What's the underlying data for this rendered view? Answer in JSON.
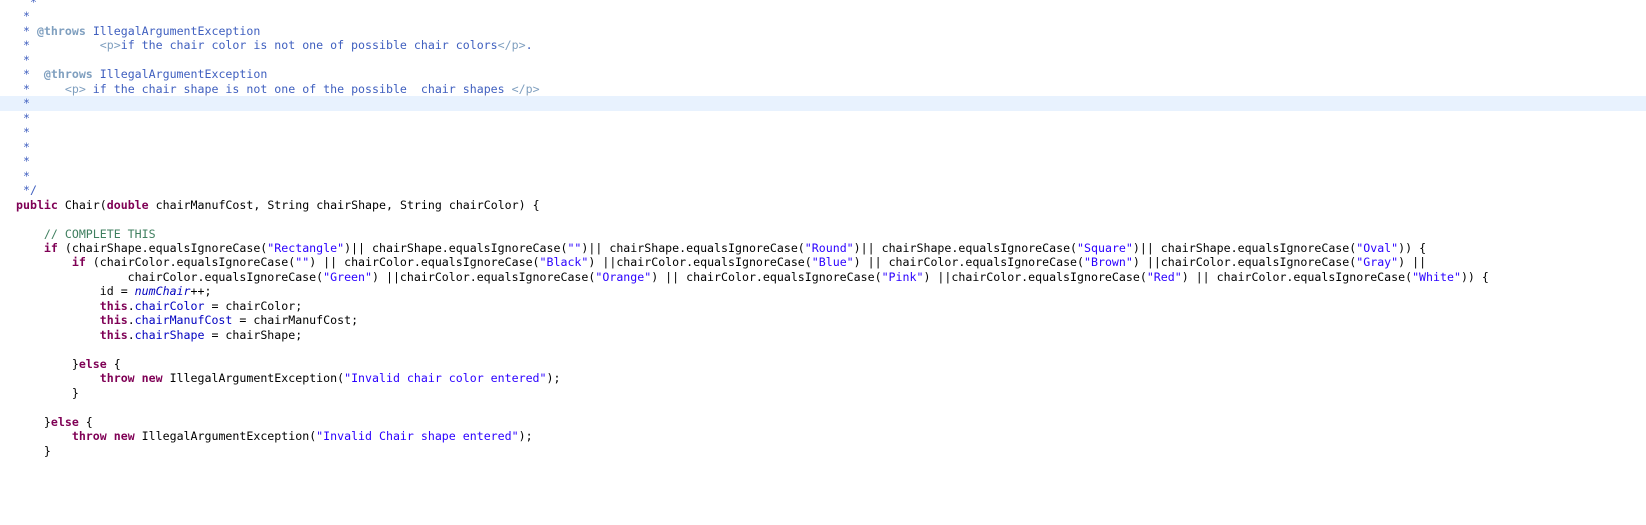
{
  "editor": {
    "app": "java-code-editor",
    "language": "Java",
    "theme_colors": {
      "background": "#ffffff",
      "current_line_highlight": "#e8f2fe",
      "javadoc": "#3f5fbf",
      "javadoc_tag": "#7f9fbf",
      "comment": "#3f7f5f",
      "keyword": "#7f0055",
      "string": "#2a00ff",
      "field": "#0000c0",
      "text": "#000000"
    },
    "highlighted_line_index": 7,
    "lines": [
      {
        "indent": 0,
        "tokens": [
          {
            "t": "  * ",
            "c": "jdoc"
          }
        ]
      },
      {
        "indent": 0,
        "tokens": [
          {
            "t": " * ",
            "c": "jdoc"
          }
        ]
      },
      {
        "indent": 0,
        "tokens": [
          {
            "t": " * ",
            "c": "jdoc"
          },
          {
            "t": "@throws",
            "c": "jdoc-kw"
          },
          {
            "t": " ",
            "c": "jdoc"
          },
          {
            "t": "IllegalArgumentException",
            "c": "jdoc"
          }
        ]
      },
      {
        "indent": 0,
        "tokens": [
          {
            "t": " *          ",
            "c": "jdoc"
          },
          {
            "t": "<p>",
            "c": "jdoc-tag"
          },
          {
            "t": "if the chair color is not one of possible chair colors",
            "c": "jdoc"
          },
          {
            "t": "</p>",
            "c": "jdoc-tag"
          },
          {
            "t": ".",
            "c": "jdoc"
          }
        ]
      },
      {
        "indent": 0,
        "tokens": [
          {
            "t": " * ",
            "c": "jdoc"
          }
        ]
      },
      {
        "indent": 0,
        "tokens": [
          {
            "t": " *  ",
            "c": "jdoc"
          },
          {
            "t": "@throws",
            "c": "jdoc-kw"
          },
          {
            "t": " ",
            "c": "jdoc"
          },
          {
            "t": "IllegalArgumentException",
            "c": "jdoc"
          }
        ]
      },
      {
        "indent": 0,
        "tokens": [
          {
            "t": " *     ",
            "c": "jdoc"
          },
          {
            "t": "<p>",
            "c": "jdoc-tag"
          },
          {
            "t": " if the chair shape is not one of the possible  chair shapes ",
            "c": "jdoc"
          },
          {
            "t": "</p>",
            "c": "jdoc-tag"
          }
        ]
      },
      {
        "indent": 0,
        "tokens": [
          {
            "t": " * ",
            "c": "jdoc"
          }
        ]
      },
      {
        "indent": 0,
        "tokens": [
          {
            "t": " * ",
            "c": "jdoc"
          }
        ]
      },
      {
        "indent": 0,
        "tokens": [
          {
            "t": " * ",
            "c": "jdoc"
          }
        ]
      },
      {
        "indent": 0,
        "tokens": [
          {
            "t": " * ",
            "c": "jdoc"
          }
        ]
      },
      {
        "indent": 0,
        "tokens": [
          {
            "t": " * ",
            "c": "jdoc"
          }
        ]
      },
      {
        "indent": 0,
        "tokens": [
          {
            "t": " * ",
            "c": "jdoc"
          }
        ]
      },
      {
        "indent": 0,
        "tokens": [
          {
            "t": " */",
            "c": "jdoc"
          }
        ]
      },
      {
        "indent": 0,
        "tokens": [
          {
            "t": "public",
            "c": "kw"
          },
          {
            "t": " Chair(",
            "c": "plain"
          },
          {
            "t": "double",
            "c": "kw"
          },
          {
            "t": " chairManufCost, ",
            "c": "plain"
          },
          {
            "t": "String",
            "c": "plain"
          },
          {
            "t": " chairShape, ",
            "c": "plain"
          },
          {
            "t": "String",
            "c": "plain"
          },
          {
            "t": " chairColor) {",
            "c": "plain"
          }
        ]
      },
      {
        "indent": 0,
        "tokens": []
      },
      {
        "indent": 0,
        "tokens": [
          {
            "t": "    ",
            "c": "plain"
          },
          {
            "t": "// COMPLETE THIS",
            "c": "cmt"
          }
        ]
      },
      {
        "indent": 0,
        "tokens": [
          {
            "t": "    ",
            "c": "plain"
          },
          {
            "t": "if",
            "c": "kw"
          },
          {
            "t": " (chairShape.equalsIgnoreCase(",
            "c": "plain"
          },
          {
            "t": "\"Rectangle\"",
            "c": "str"
          },
          {
            "t": ")|| chairShape.equalsIgnoreCase(",
            "c": "plain"
          },
          {
            "t": "\"\"",
            "c": "str"
          },
          {
            "t": ")|| chairShape.equalsIgnoreCase(",
            "c": "plain"
          },
          {
            "t": "\"Round\"",
            "c": "str"
          },
          {
            "t": ")|| chairShape.equalsIgnoreCase(",
            "c": "plain"
          },
          {
            "t": "\"Square\"",
            "c": "str"
          },
          {
            "t": ")|| chairShape.equalsIgnoreCase(",
            "c": "plain"
          },
          {
            "t": "\"Oval\"",
            "c": "str"
          },
          {
            "t": ")) {",
            "c": "plain"
          }
        ]
      },
      {
        "indent": 0,
        "tokens": [
          {
            "t": "        ",
            "c": "plain"
          },
          {
            "t": "if",
            "c": "kw"
          },
          {
            "t": " (chairColor.equalsIgnoreCase(",
            "c": "plain"
          },
          {
            "t": "\"\"",
            "c": "str"
          },
          {
            "t": ") || chairColor.equalsIgnoreCase(",
            "c": "plain"
          },
          {
            "t": "\"Black\"",
            "c": "str"
          },
          {
            "t": ") ||chairColor.equalsIgnoreCase(",
            "c": "plain"
          },
          {
            "t": "\"Blue\"",
            "c": "str"
          },
          {
            "t": ") || chairColor.equalsIgnoreCase(",
            "c": "plain"
          },
          {
            "t": "\"Brown\"",
            "c": "str"
          },
          {
            "t": ") ||chairColor.equalsIgnoreCase(",
            "c": "plain"
          },
          {
            "t": "\"Gray\"",
            "c": "str"
          },
          {
            "t": ") ||",
            "c": "plain"
          }
        ]
      },
      {
        "indent": 0,
        "tokens": [
          {
            "t": "                chairColor.equalsIgnoreCase(",
            "c": "plain"
          },
          {
            "t": "\"Green\"",
            "c": "str"
          },
          {
            "t": ") ||chairColor.equalsIgnoreCase(",
            "c": "plain"
          },
          {
            "t": "\"Orange\"",
            "c": "str"
          },
          {
            "t": ") || chairColor.equalsIgnoreCase(",
            "c": "plain"
          },
          {
            "t": "\"Pink\"",
            "c": "str"
          },
          {
            "t": ") ||chairColor.equalsIgnoreCase(",
            "c": "plain"
          },
          {
            "t": "\"Red\"",
            "c": "str"
          },
          {
            "t": ") || chairColor.equalsIgnoreCase(",
            "c": "plain"
          },
          {
            "t": "\"White\"",
            "c": "str"
          },
          {
            "t": ")) {",
            "c": "plain"
          }
        ]
      },
      {
        "indent": 0,
        "tokens": [
          {
            "t": "            id = ",
            "c": "plain"
          },
          {
            "t": "numChair",
            "c": "sfld"
          },
          {
            "t": "++;",
            "c": "plain"
          }
        ]
      },
      {
        "indent": 0,
        "tokens": [
          {
            "t": "            ",
            "c": "plain"
          },
          {
            "t": "this",
            "c": "kw"
          },
          {
            "t": ".",
            "c": "plain"
          },
          {
            "t": "chairColor",
            "c": "fld"
          },
          {
            "t": " = chairColor;",
            "c": "plain"
          }
        ]
      },
      {
        "indent": 0,
        "tokens": [
          {
            "t": "            ",
            "c": "plain"
          },
          {
            "t": "this",
            "c": "kw"
          },
          {
            "t": ".",
            "c": "plain"
          },
          {
            "t": "chairManufCost",
            "c": "fld"
          },
          {
            "t": " = chairManufCost;",
            "c": "plain"
          }
        ]
      },
      {
        "indent": 0,
        "tokens": [
          {
            "t": "            ",
            "c": "plain"
          },
          {
            "t": "this",
            "c": "kw"
          },
          {
            "t": ".",
            "c": "plain"
          },
          {
            "t": "chairShape",
            "c": "fld"
          },
          {
            "t": " = chairShape;",
            "c": "plain"
          }
        ]
      },
      {
        "indent": 0,
        "tokens": []
      },
      {
        "indent": 0,
        "tokens": [
          {
            "t": "        }",
            "c": "plain"
          },
          {
            "t": "else",
            "c": "kw"
          },
          {
            "t": " {",
            "c": "plain"
          }
        ]
      },
      {
        "indent": 0,
        "tokens": [
          {
            "t": "            ",
            "c": "plain"
          },
          {
            "t": "throw",
            "c": "kw"
          },
          {
            "t": " ",
            "c": "plain"
          },
          {
            "t": "new",
            "c": "kw"
          },
          {
            "t": " IllegalArgumentException(",
            "c": "plain"
          },
          {
            "t": "\"Invalid chair color entered\"",
            "c": "str"
          },
          {
            "t": ");",
            "c": "plain"
          }
        ]
      },
      {
        "indent": 0,
        "tokens": [
          {
            "t": "        }",
            "c": "plain"
          }
        ]
      },
      {
        "indent": 0,
        "tokens": []
      },
      {
        "indent": 0,
        "tokens": [
          {
            "t": "    }",
            "c": "plain"
          },
          {
            "t": "else",
            "c": "kw"
          },
          {
            "t": " {",
            "c": "plain"
          }
        ]
      },
      {
        "indent": 0,
        "tokens": [
          {
            "t": "        ",
            "c": "plain"
          },
          {
            "t": "throw",
            "c": "kw"
          },
          {
            "t": " ",
            "c": "plain"
          },
          {
            "t": "new",
            "c": "kw"
          },
          {
            "t": " IllegalArgumentException(",
            "c": "plain"
          },
          {
            "t": "\"Invalid Chair shape entered\"",
            "c": "str"
          },
          {
            "t": ");",
            "c": "plain"
          }
        ]
      },
      {
        "indent": 0,
        "tokens": [
          {
            "t": "    }",
            "c": "plain"
          }
        ]
      },
      {
        "indent": 0,
        "tokens": []
      }
    ]
  }
}
